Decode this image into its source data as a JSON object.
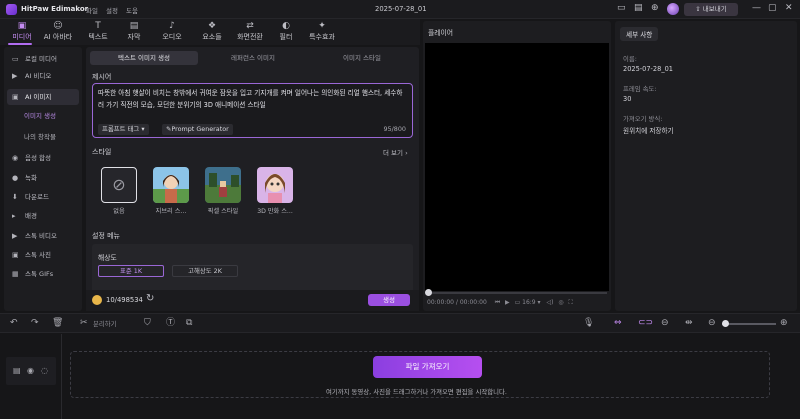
{
  "app": {
    "name": "HitPaw Edimakor",
    "date": "2025-07-28_01",
    "export_label": "내보내기",
    "menu": [
      "파일",
      "설정",
      "도움"
    ]
  },
  "tabs": [
    {
      "label": "미디어",
      "icon": "media-icon",
      "glyph": "▣",
      "active": true
    },
    {
      "label": "AI 아바타",
      "icon": "avatar-icon",
      "glyph": "☺",
      "active": false
    },
    {
      "label": "텍스트",
      "icon": "text-icon",
      "glyph": "T",
      "active": false
    },
    {
      "label": "자막",
      "icon": "subtitle-icon",
      "glyph": "▤",
      "active": false
    },
    {
      "label": "오디오",
      "icon": "audio-icon",
      "glyph": "♪",
      "active": false
    },
    {
      "label": "요소들",
      "icon": "elements-icon",
      "glyph": "❖",
      "active": false
    },
    {
      "label": "화면전환",
      "icon": "transition-icon",
      "glyph": "⇄",
      "active": false
    },
    {
      "label": "필터",
      "icon": "filter-icon",
      "glyph": "◐",
      "active": false
    },
    {
      "label": "특수효과",
      "icon": "effects-icon",
      "glyph": "✦",
      "active": false
    }
  ],
  "sidebar": {
    "items": [
      {
        "label": "로컬 미디어",
        "glyph": "▭"
      },
      {
        "label": "AI 비디오",
        "glyph": "▶"
      },
      {
        "label": "AI 이미지",
        "glyph": "▣"
      },
      {
        "label": "음성 합성",
        "glyph": "◉"
      },
      {
        "label": "녹화",
        "glyph": "●"
      },
      {
        "label": "다운로드",
        "glyph": "⬇"
      },
      {
        "label": "배경",
        "glyph": "▸"
      },
      {
        "label": "스톡 비디오",
        "glyph": "▶"
      },
      {
        "label": "스톡 사진",
        "glyph": "▣"
      },
      {
        "label": "스톡 GIFs",
        "glyph": "▦"
      }
    ],
    "sub_items": [
      "이미지 생성",
      "나의 창작물"
    ]
  },
  "panel": {
    "tabs": [
      "텍스트 이미지 생성",
      "레퍼런스 이미지",
      "이미지 스타일"
    ],
    "prompt_label": "제시어",
    "prompt_text": "따뜻한 아침 햇살이 비치는 창밖에서 귀여운 잠옷을 입고 기지개를 켜며 일어나는 의인화된 리얼 햄스터, 세수하러 가기 직전의 모습, 모던한 분위기의 3D 애니메이션 스타일",
    "prompt_tag": "프롬프트 태그",
    "prompt_generator": "Prompt Generator",
    "char_count": "95/800",
    "style_label": "스타일",
    "more_label": "더 보기",
    "styles": [
      "없음",
      "지브리 스...",
      "픽셀 스타일",
      "3D 만화 스..."
    ],
    "settings_label": "설정 메뉴",
    "resolution_label": "해상도",
    "resolutions": [
      "표준 1K",
      "고해상도 2K"
    ],
    "credits": "10/498534",
    "generate": "생성"
  },
  "player": {
    "title": "플레이어",
    "time": "00:00:00",
    "duration": "00:00:00",
    "ratio": "16:9"
  },
  "details": {
    "tab": "세부 사항",
    "name_key": "이름:",
    "name_val": "2025-07-28_01",
    "fps_key": "프레임 속도:",
    "fps_val": "30",
    "save_key": "가져오기 방식:",
    "save_val": "원위치에 저장하기"
  },
  "toolbar": {
    "split_label": "분리하기"
  },
  "timeline": {
    "import_label": "파일 가져오기",
    "hint": "여기까지 동영상, 사진을 드래그하거나 가져오면 편집을 시작합니다."
  },
  "colors": {
    "accent": "#9a4fe0",
    "accent_text": "#c58cf2"
  }
}
